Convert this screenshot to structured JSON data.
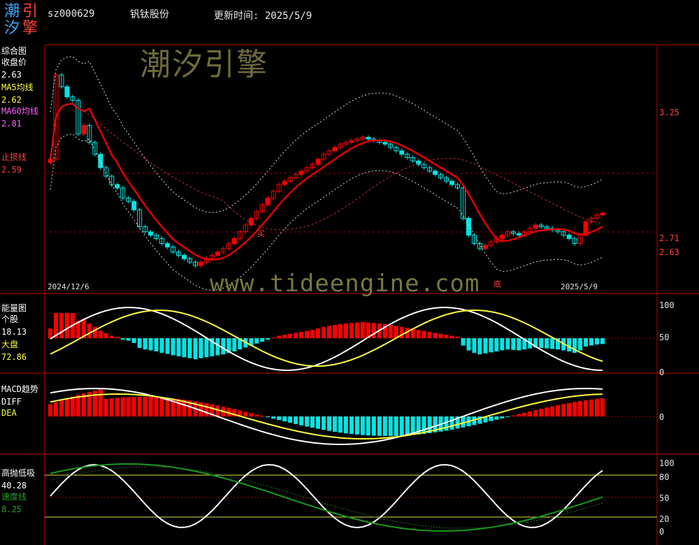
{
  "header": {
    "logo_chars": [
      "潮",
      "引",
      "汐",
      "擎"
    ],
    "stock_code": "sz000629",
    "stock_name": "钒钛股份",
    "update_label": "更新时间: 2025/5/9"
  },
  "watermark": {
    "brand": "潮汐引擎",
    "url": "www.tideengine.com"
  },
  "colors": {
    "up": "#ff0000",
    "down": "#00e5e5",
    "grid": "#c00000",
    "ma5": "#ffffff",
    "ma60": "#e00000",
    "yellow": "#ffff40",
    "green": "#1a9a1a"
  },
  "panel_main": {
    "title": "综合图",
    "close_label": "收盘价",
    "close_value": "2.63",
    "ma5_label": "MA5均线",
    "ma5_value": "2.62",
    "ma60_label": "MA60均线",
    "ma60_value": "2.81",
    "stop_label": "止损线",
    "stop_value": "2.59",
    "axis_ticks": [
      "3.25",
      "2.71",
      "2.63"
    ],
    "date_start": "2024/12/6",
    "date_end": "2025/5/9",
    "marker_buy": "买",
    "marker_low": "底"
  },
  "panel_energy": {
    "title": "能量图",
    "stock_label": "个股",
    "stock_value": "18.13",
    "market_label": "大盘",
    "market_value": "72.86",
    "axis_ticks": [
      "100",
      "50",
      "0"
    ]
  },
  "panel_macd": {
    "title": "MACD趋势",
    "diff_label": "DIFF",
    "dea_label": "DEA",
    "axis_ticks": [
      "0"
    ]
  },
  "panel_kdj": {
    "title": "高抛低吸",
    "value": "40.28",
    "speed_label": "速度线",
    "speed_value": "8.25",
    "axis_ticks": [
      "100",
      "80",
      "50",
      "20",
      "0"
    ]
  },
  "chart_data": {
    "type": "candlestick",
    "x_range": [
      "2024/12/6",
      "2025/5/9"
    ],
    "close_series_approx": [
      2.95,
      3.45,
      3.38,
      3.32,
      3.3,
      3.1,
      3.15,
      3.05,
      2.98,
      2.9,
      2.85,
      2.8,
      2.78,
      2.72,
      2.7,
      2.65,
      2.55,
      2.52,
      2.5,
      2.48,
      2.45,
      2.43,
      2.4,
      2.38,
      2.36,
      2.34,
      2.32,
      2.34,
      2.36,
      2.38,
      2.4,
      2.42,
      2.45,
      2.48,
      2.52,
      2.56,
      2.6,
      2.64,
      2.68,
      2.72,
      2.76,
      2.8,
      2.82,
      2.84,
      2.86,
      2.88,
      2.9,
      2.92,
      2.95,
      2.98,
      3.0,
      3.02,
      3.04,
      3.05,
      3.06,
      3.07,
      3.08,
      3.07,
      3.06,
      3.05,
      3.04,
      3.02,
      3.0,
      2.98,
      2.96,
      2.94,
      2.92,
      2.9,
      2.88,
      2.86,
      2.84,
      2.82,
      2.8,
      2.78,
      2.6,
      2.5,
      2.45,
      2.42,
      2.44,
      2.46,
      2.48,
      2.5,
      2.52,
      2.51,
      2.5,
      2.52,
      2.54,
      2.56,
      2.55,
      2.54,
      2.53,
      2.52,
      2.5,
      2.48,
      2.45,
      2.5,
      2.58,
      2.6,
      2.62,
      2.63
    ],
    "ma60_latest": 2.81,
    "ma5_latest": 2.62,
    "stop_latest": 2.59
  }
}
